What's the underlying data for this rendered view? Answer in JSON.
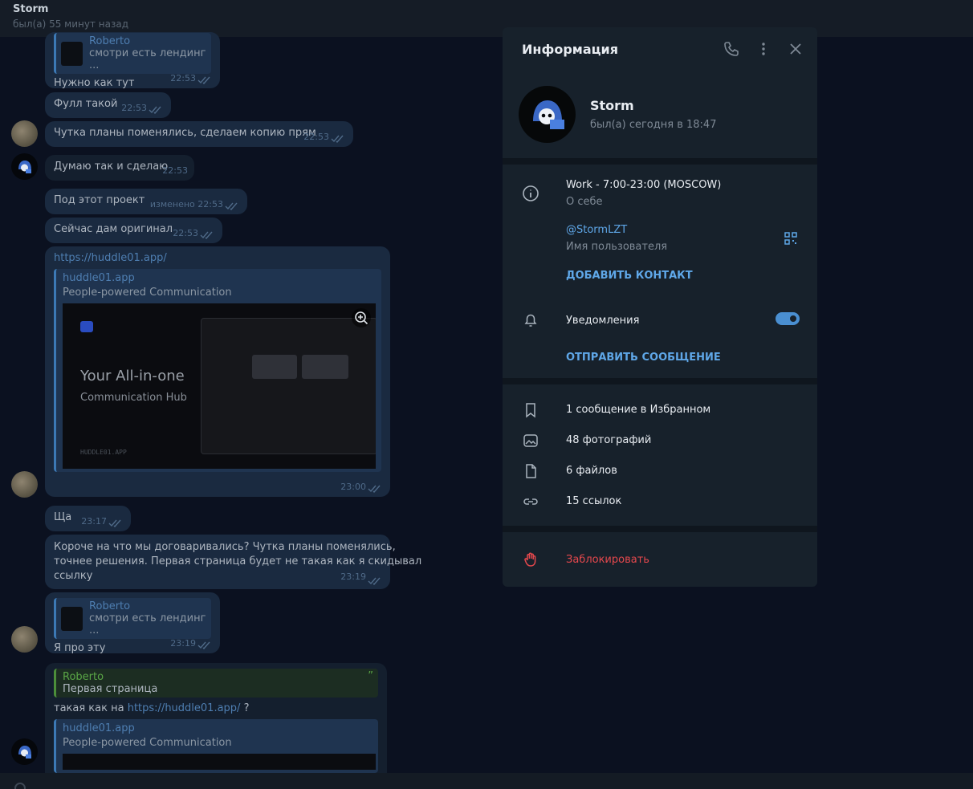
{
  "header": {
    "name": "Storm",
    "status": "был(а) 55 минут назад"
  },
  "messages": [
    {
      "reply_author": "Roberto",
      "reply_text": "смотри есть лендинг ...",
      "text": "Нужно как тут",
      "time": "22:53"
    },
    {
      "text": "Фулл такой",
      "time": "22:53"
    },
    {
      "text": "Чутка планы поменялись, сделаем копию прям",
      "time": "22:53"
    },
    {
      "text": "Думаю так и сделаю",
      "time": "22:53"
    },
    {
      "text": "Под этот проект",
      "time": "изменено 22:53"
    },
    {
      "text": "Сейчас дам оригинал",
      "time": "22:53"
    },
    {
      "link": "https://huddle01.app/",
      "preview_site": "huddle01.app",
      "preview_desc": "People-powered Communication",
      "preview_hero": "Your All-in-one",
      "preview_hero2": "Communication Hub",
      "preview_footer": "HUDDLE01.APP",
      "time": "23:00"
    },
    {
      "text": "Ща",
      "time": "23:17"
    },
    {
      "text_lines": [
        "Короче на что мы договаривались? Чутка планы поменялись,",
        "точнее решения. Первая страница будет не такая как я скидывал",
        "ссылку"
      ],
      "time": "23:19"
    },
    {
      "reply_author": "Roberto",
      "reply_text": "смотри есть лендинг ...",
      "text": "Я про эту",
      "time": "23:19"
    },
    {
      "quote_author": "Roberto",
      "quote_text": "Первая страница",
      "quote_mark": "”",
      "text_before": "такая как на ",
      "link": "https://huddle01.app/",
      "text_after": " ?",
      "preview_site": "huddle01.app",
      "preview_desc": "People-powered Communication"
    }
  ],
  "info": {
    "title": "Информация",
    "name": "Storm",
    "seen": "был(а) сегодня в 18:47",
    "bio": "Work - 7:00-23:00 (MOSCOW)",
    "bio_label": "О себе",
    "username": "@StormLZT",
    "username_label": "Имя пользователя",
    "add_contact": "ДОБАВИТЬ КОНТАКТ",
    "notifications": "Уведомления",
    "notifications_on": true,
    "send_message": "ОТПРАВИТЬ СООБЩЕНИЕ",
    "saved": "1 сообщение в Избранном",
    "photos": "48 фотографий",
    "files": "6 файлов",
    "links": "15 ссылок",
    "block": "Заблокировать"
  },
  "colors": {
    "bubble": "#1a2a40",
    "panel": "#17212b",
    "accent": "#5fa7e8",
    "danger": "#e5484d",
    "reply_accent": "#3c79b5",
    "quote_accent": "#5aa646"
  }
}
